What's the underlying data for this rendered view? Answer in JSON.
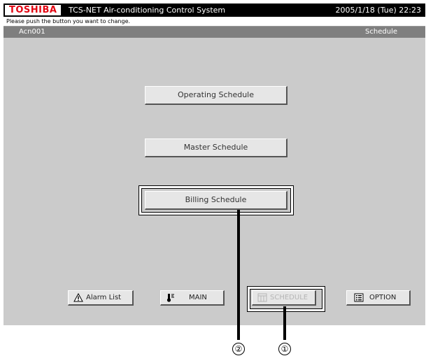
{
  "header": {
    "brand": "TOSHIBA",
    "app_title": "TCS-NET Air-conditioning Control System",
    "datetime": "2005/1/18 (Tue)  22:23"
  },
  "instruction": "Please push the button you want to change.",
  "nav": {
    "device_id": "Acn001",
    "page": "Schedule"
  },
  "schedule_buttons": {
    "operating": "Operating Schedule",
    "master": "Master Schedule",
    "billing": "Billing Schedule"
  },
  "footer_buttons": {
    "alarm": {
      "label": "Alarm List",
      "icon": "alarm-warning-icon"
    },
    "main": {
      "label": "MAIN",
      "icon": "thermometer-icon"
    },
    "schedule": {
      "label": "SCHEDULE",
      "icon": "calendar-icon",
      "state": "disabled"
    },
    "option": {
      "label": "OPTION",
      "icon": "list-icon"
    }
  },
  "callouts": {
    "one": "①",
    "two": "②"
  },
  "colors": {
    "brand_red": "#e30613",
    "screen_bg": "#cbcbcb",
    "nav_bg": "#7f7f7f",
    "title_bg": "#000000"
  }
}
